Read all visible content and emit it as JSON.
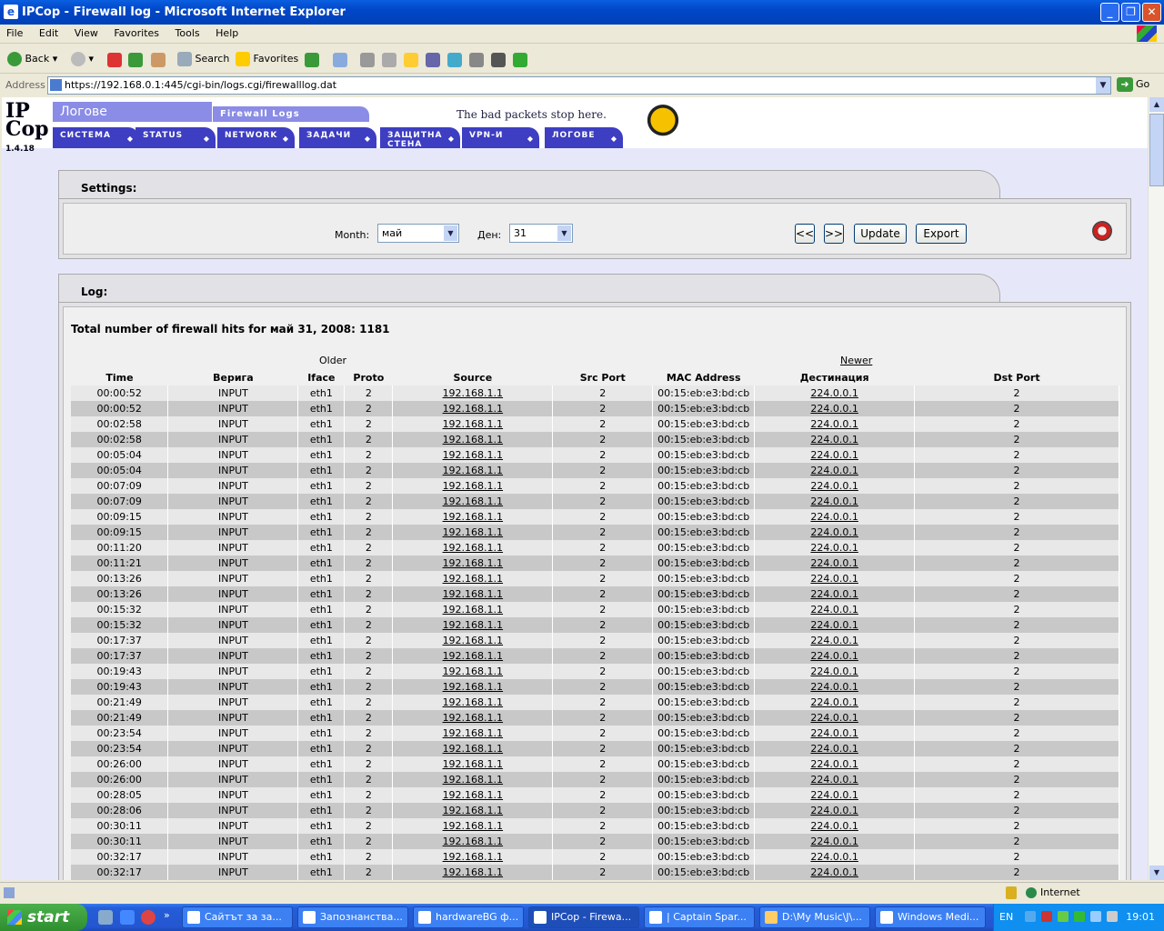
{
  "window": {
    "title": "IPCop - Firewall log - Microsoft Internet Explorer"
  },
  "menu": [
    "File",
    "Edit",
    "View",
    "Favorites",
    "Tools",
    "Help"
  ],
  "toolbar": {
    "back": "Back",
    "search": "Search",
    "favorites": "Favorites"
  },
  "address": {
    "label": "Address",
    "url": "https://192.168.0.1:445/cgi-bin/logs.cgi/firewalllog.dat",
    "go": "Go"
  },
  "ipcop": {
    "logo": "IP Cop",
    "version": "1.4.18",
    "section": "Логове",
    "subsection": "Firewall Logs",
    "slogan": "The bad packets stop here.",
    "nav": [
      "СИСТЕМА",
      "STATUS",
      "NETWORK",
      "ЗАДАЧИ",
      "ЗАЩИТНА СТЕНА",
      "VPN-И",
      "ЛОГОВЕ"
    ]
  },
  "settings": {
    "title": "Settings:",
    "month_label": "Month:",
    "month_value": "май",
    "day_label": "Ден:",
    "day_value": "31",
    "prev": "<<",
    "next": ">>",
    "update": "Update",
    "export": "Export"
  },
  "log": {
    "title": "Log:",
    "total": "Total number of firewall hits for май 31, 2008: 1181",
    "older": "Older",
    "newer": "Newer",
    "headers": [
      "Time",
      "Верига",
      "Iface",
      "Proto",
      "Source",
      "Src Port",
      "MAC Address",
      "Дестинация",
      "Dst Port"
    ],
    "rows": [
      [
        "00:00:52",
        "INPUT",
        "eth1",
        "2",
        "192.168.1.1",
        "2",
        "00:15:eb:e3:bd:cb",
        "224.0.0.1",
        "2"
      ],
      [
        "00:00:52",
        "INPUT",
        "eth1",
        "2",
        "192.168.1.1",
        "2",
        "00:15:eb:e3:bd:cb",
        "224.0.0.1",
        "2"
      ],
      [
        "00:02:58",
        "INPUT",
        "eth1",
        "2",
        "192.168.1.1",
        "2",
        "00:15:eb:e3:bd:cb",
        "224.0.0.1",
        "2"
      ],
      [
        "00:02:58",
        "INPUT",
        "eth1",
        "2",
        "192.168.1.1",
        "2",
        "00:15:eb:e3:bd:cb",
        "224.0.0.1",
        "2"
      ],
      [
        "00:05:04",
        "INPUT",
        "eth1",
        "2",
        "192.168.1.1",
        "2",
        "00:15:eb:e3:bd:cb",
        "224.0.0.1",
        "2"
      ],
      [
        "00:05:04",
        "INPUT",
        "eth1",
        "2",
        "192.168.1.1",
        "2",
        "00:15:eb:e3:bd:cb",
        "224.0.0.1",
        "2"
      ],
      [
        "00:07:09",
        "INPUT",
        "eth1",
        "2",
        "192.168.1.1",
        "2",
        "00:15:eb:e3:bd:cb",
        "224.0.0.1",
        "2"
      ],
      [
        "00:07:09",
        "INPUT",
        "eth1",
        "2",
        "192.168.1.1",
        "2",
        "00:15:eb:e3:bd:cb",
        "224.0.0.1",
        "2"
      ],
      [
        "00:09:15",
        "INPUT",
        "eth1",
        "2",
        "192.168.1.1",
        "2",
        "00:15:eb:e3:bd:cb",
        "224.0.0.1",
        "2"
      ],
      [
        "00:09:15",
        "INPUT",
        "eth1",
        "2",
        "192.168.1.1",
        "2",
        "00:15:eb:e3:bd:cb",
        "224.0.0.1",
        "2"
      ],
      [
        "00:11:20",
        "INPUT",
        "eth1",
        "2",
        "192.168.1.1",
        "2",
        "00:15:eb:e3:bd:cb",
        "224.0.0.1",
        "2"
      ],
      [
        "00:11:21",
        "INPUT",
        "eth1",
        "2",
        "192.168.1.1",
        "2",
        "00:15:eb:e3:bd:cb",
        "224.0.0.1",
        "2"
      ],
      [
        "00:13:26",
        "INPUT",
        "eth1",
        "2",
        "192.168.1.1",
        "2",
        "00:15:eb:e3:bd:cb",
        "224.0.0.1",
        "2"
      ],
      [
        "00:13:26",
        "INPUT",
        "eth1",
        "2",
        "192.168.1.1",
        "2",
        "00:15:eb:e3:bd:cb",
        "224.0.0.1",
        "2"
      ],
      [
        "00:15:32",
        "INPUT",
        "eth1",
        "2",
        "192.168.1.1",
        "2",
        "00:15:eb:e3:bd:cb",
        "224.0.0.1",
        "2"
      ],
      [
        "00:15:32",
        "INPUT",
        "eth1",
        "2",
        "192.168.1.1",
        "2",
        "00:15:eb:e3:bd:cb",
        "224.0.0.1",
        "2"
      ],
      [
        "00:17:37",
        "INPUT",
        "eth1",
        "2",
        "192.168.1.1",
        "2",
        "00:15:eb:e3:bd:cb",
        "224.0.0.1",
        "2"
      ],
      [
        "00:17:37",
        "INPUT",
        "eth1",
        "2",
        "192.168.1.1",
        "2",
        "00:15:eb:e3:bd:cb",
        "224.0.0.1",
        "2"
      ],
      [
        "00:19:43",
        "INPUT",
        "eth1",
        "2",
        "192.168.1.1",
        "2",
        "00:15:eb:e3:bd:cb",
        "224.0.0.1",
        "2"
      ],
      [
        "00:19:43",
        "INPUT",
        "eth1",
        "2",
        "192.168.1.1",
        "2",
        "00:15:eb:e3:bd:cb",
        "224.0.0.1",
        "2"
      ],
      [
        "00:21:49",
        "INPUT",
        "eth1",
        "2",
        "192.168.1.1",
        "2",
        "00:15:eb:e3:bd:cb",
        "224.0.0.1",
        "2"
      ],
      [
        "00:21:49",
        "INPUT",
        "eth1",
        "2",
        "192.168.1.1",
        "2",
        "00:15:eb:e3:bd:cb",
        "224.0.0.1",
        "2"
      ],
      [
        "00:23:54",
        "INPUT",
        "eth1",
        "2",
        "192.168.1.1",
        "2",
        "00:15:eb:e3:bd:cb",
        "224.0.0.1",
        "2"
      ],
      [
        "00:23:54",
        "INPUT",
        "eth1",
        "2",
        "192.168.1.1",
        "2",
        "00:15:eb:e3:bd:cb",
        "224.0.0.1",
        "2"
      ],
      [
        "00:26:00",
        "INPUT",
        "eth1",
        "2",
        "192.168.1.1",
        "2",
        "00:15:eb:e3:bd:cb",
        "224.0.0.1",
        "2"
      ],
      [
        "00:26:00",
        "INPUT",
        "eth1",
        "2",
        "192.168.1.1",
        "2",
        "00:15:eb:e3:bd:cb",
        "224.0.0.1",
        "2"
      ],
      [
        "00:28:05",
        "INPUT",
        "eth1",
        "2",
        "192.168.1.1",
        "2",
        "00:15:eb:e3:bd:cb",
        "224.0.0.1",
        "2"
      ],
      [
        "00:28:06",
        "INPUT",
        "eth1",
        "2",
        "192.168.1.1",
        "2",
        "00:15:eb:e3:bd:cb",
        "224.0.0.1",
        "2"
      ],
      [
        "00:30:11",
        "INPUT",
        "eth1",
        "2",
        "192.168.1.1",
        "2",
        "00:15:eb:e3:bd:cb",
        "224.0.0.1",
        "2"
      ],
      [
        "00:30:11",
        "INPUT",
        "eth1",
        "2",
        "192.168.1.1",
        "2",
        "00:15:eb:e3:bd:cb",
        "224.0.0.1",
        "2"
      ],
      [
        "00:32:17",
        "INPUT",
        "eth1",
        "2",
        "192.168.1.1",
        "2",
        "00:15:eb:e3:bd:cb",
        "224.0.0.1",
        "2"
      ],
      [
        "00:32:17",
        "INPUT",
        "eth1",
        "2",
        "192.168.1.1",
        "2",
        "00:15:eb:e3:bd:cb",
        "224.0.0.1",
        "2"
      ]
    ]
  },
  "status": {
    "zone": "Internet"
  },
  "taskbar": {
    "start": "start",
    "tasks": [
      "Сайтът за за...",
      "Запознанства...",
      "hardwareBG ф...",
      "IPCop - Firewa...",
      "| Captain Spar...",
      "D:\\My Music\\J\\...",
      "Windows Medi..."
    ],
    "lang": "EN",
    "clock": "19:01"
  }
}
